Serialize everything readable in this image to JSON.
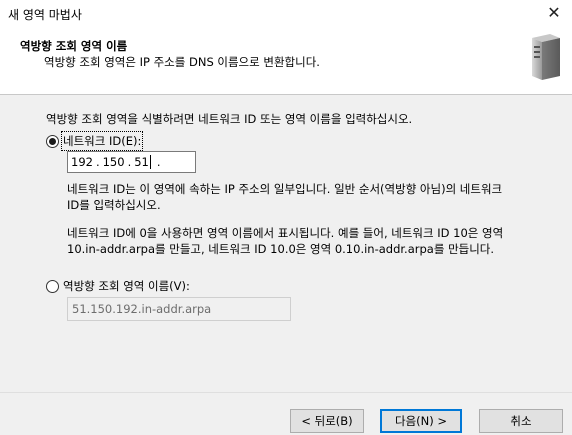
{
  "window": {
    "title": "새 영역 마법사",
    "close_glyph": "✕"
  },
  "header": {
    "title": "역방향 조회 영역 이름",
    "subtitle": "역방향 조회 영역은 IP 주소를 DNS 이름으로 변환합니다."
  },
  "intro_text": "역방향 조회 영역을 식별하려면 네트워크 ID 또는 영역 이름을 입력하십시오.",
  "network_id": {
    "label": "네트워크 ID(E):",
    "selected": true,
    "octets": [
      "192",
      "150",
      "51",
      ""
    ],
    "desc1_line1": "네트워크 ID는 이 영역에 속하는 IP 주소의 일부입니다. 일반 순서(역방향 아님)의 네트워크",
    "desc1_line2": "ID를 입력하십시오.",
    "desc2_line1": "네트워크 ID에 0을 사용하면 영역 이름에서 표시됩니다. 예를 들어, 네트워크 ID 10은 영역",
    "desc2_line2": "10.in-addr.arpa를 만들고, 네트워크 ID 10.0은 영역 0.10.in-addr.arpa를 만듭니다."
  },
  "zone_name": {
    "label": "역방향 조회 영역 이름(V):",
    "selected": false,
    "value": "51.150.192.in-addr.arpa"
  },
  "buttons": {
    "back": "< 뒤로(B)",
    "next": "다음(N) >",
    "cancel": "취소"
  },
  "icons": {
    "header": "server-icon"
  }
}
